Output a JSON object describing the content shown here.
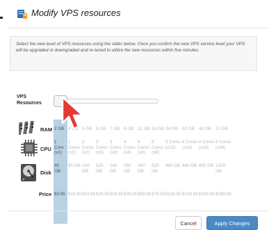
{
  "window": {
    "title": "Modify VPS resources"
  },
  "info": {
    "text": "Select the new level of VPS resources using the slider below. Once you confirm the new VPS service level your VPS will be upgraded or downgraded and re-tuned to utilize the new resources within five minutes."
  },
  "slider": {
    "label_line1": "VPS",
    "label_line2": "Resources",
    "selected_index": 0,
    "level_count": 14
  },
  "rows": {
    "ram": {
      "label": "RAM",
      "icon": "memory-icon",
      "options": [
        "2 GB",
        "4 GB",
        "5 GB",
        "6 GB",
        "7 GB",
        "8 GB",
        "12 GB",
        "16 GB",
        "24 GB",
        "32 GB",
        "48 GB",
        "72 GB"
      ]
    },
    "cpu": {
      "label": "CPU",
      "icon": "cpu-chip-icon",
      "options": [
        [
          "1",
          "Core",
          "(x1)"
        ],
        [
          "2",
          "Cores",
          "(x2)"
        ],
        [
          "2",
          "Cores",
          "(x2)"
        ],
        [
          "3",
          "Cores",
          "(x3)"
        ],
        [
          "3",
          "Cores",
          "(x3)"
        ],
        [
          "4",
          "Cores",
          "(x4)"
        ],
        [
          "6",
          "Cores",
          "(x6)"
        ],
        [
          "8",
          "Cores",
          "(x8)"
        ],
        [
          "8 Cores",
          "(x12)"
        ],
        [
          "8 Cores",
          "(x16)"
        ],
        [
          "8 Cores",
          "(x24)"
        ],
        [
          "8 Cores",
          "(x36)"
        ]
      ]
    },
    "disk": {
      "label": "Disk",
      "icon": "hard-disk-icon",
      "options": [
        [
          "40",
          "GB"
        ],
        [
          "80 GB"
        ],
        [
          "100",
          "GB"
        ],
        [
          "120",
          "GB"
        ],
        [
          "140",
          "GB"
        ],
        [
          "160",
          "GB"
        ],
        [
          "240",
          "GB"
        ],
        [
          "320",
          "GB"
        ],
        [
          "480 GB"
        ],
        [
          "640 GB"
        ],
        [
          "800 GB"
        ],
        [
          "1200",
          "GB"
        ]
      ]
    },
    "price": {
      "label": "Price",
      "options": [
        "$9.95",
        "$19.95",
        "$24.95",
        "$29.95",
        "$34.95",
        "$39.95",
        "$59.95",
        "$79.95",
        "$119.95",
        "$159.95",
        "$199.95",
        "$299.95"
      ]
    }
  },
  "footer": {
    "cancel_label": "Cancel",
    "apply_label": "Apply Changes"
  },
  "colors": {
    "accent": "#4a8ac4",
    "highlight": "#b8d1e3",
    "cursor": "#e53935"
  }
}
